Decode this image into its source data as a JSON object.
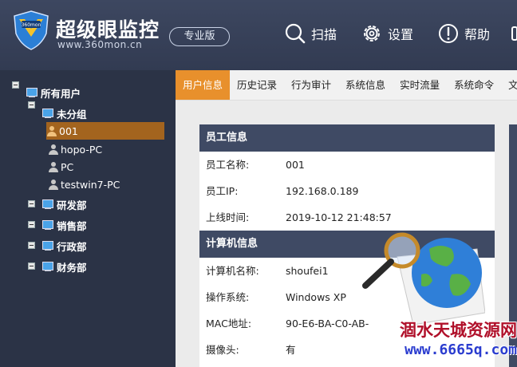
{
  "header": {
    "logo_badge": "360mon",
    "title": "超级眼监控",
    "url": "www.360mon.cn",
    "edition": "专业版",
    "buttons": [
      {
        "label": "扫描",
        "icon": "search-icon"
      },
      {
        "label": "设置",
        "icon": "gear-icon"
      },
      {
        "label": "帮助",
        "icon": "help-icon"
      }
    ]
  },
  "sidebar": {
    "root": "所有用户",
    "groups": [
      {
        "label": "未分组",
        "children": [
          "001",
          "hopo-PC",
          "PC",
          "testwin7-PC"
        ]
      },
      {
        "label": "研发部"
      },
      {
        "label": "销售部"
      },
      {
        "label": "行政部"
      },
      {
        "label": "财务部"
      }
    ],
    "selected": "001"
  },
  "tabs": [
    "用户信息",
    "历史记录",
    "行为审计",
    "系统信息",
    "实时流量",
    "系统命令",
    "文"
  ],
  "active_tab": "用户信息",
  "employee_section": {
    "title": "员工信息",
    "rows": [
      {
        "label": "员工名称:",
        "value": "001"
      },
      {
        "label": "员工IP:",
        "value": "192.168.0.189"
      },
      {
        "label": "上线时间:",
        "value": "2019-10-12 21:48:57"
      }
    ]
  },
  "computer_section": {
    "title": "计算机信息",
    "rows": [
      {
        "label": "计算机名称:",
        "value": "shoufei1"
      },
      {
        "label": "操作系统:",
        "value": "Windows XP"
      },
      {
        "label": "MAC地址:",
        "value": "90-E6-BA-C0-AB-"
      },
      {
        "label": "摄像头:",
        "value": "有"
      }
    ]
  },
  "watermark": {
    "line1": "涸水天城资源网",
    "line2": "www.6665q.com"
  },
  "colors": {
    "header_bg": "#3a4459",
    "sidebar_bg": "#2b3346",
    "active_tab": "#e8902c",
    "section_head": "#3f4a64",
    "selected_node": "#a3641e"
  }
}
